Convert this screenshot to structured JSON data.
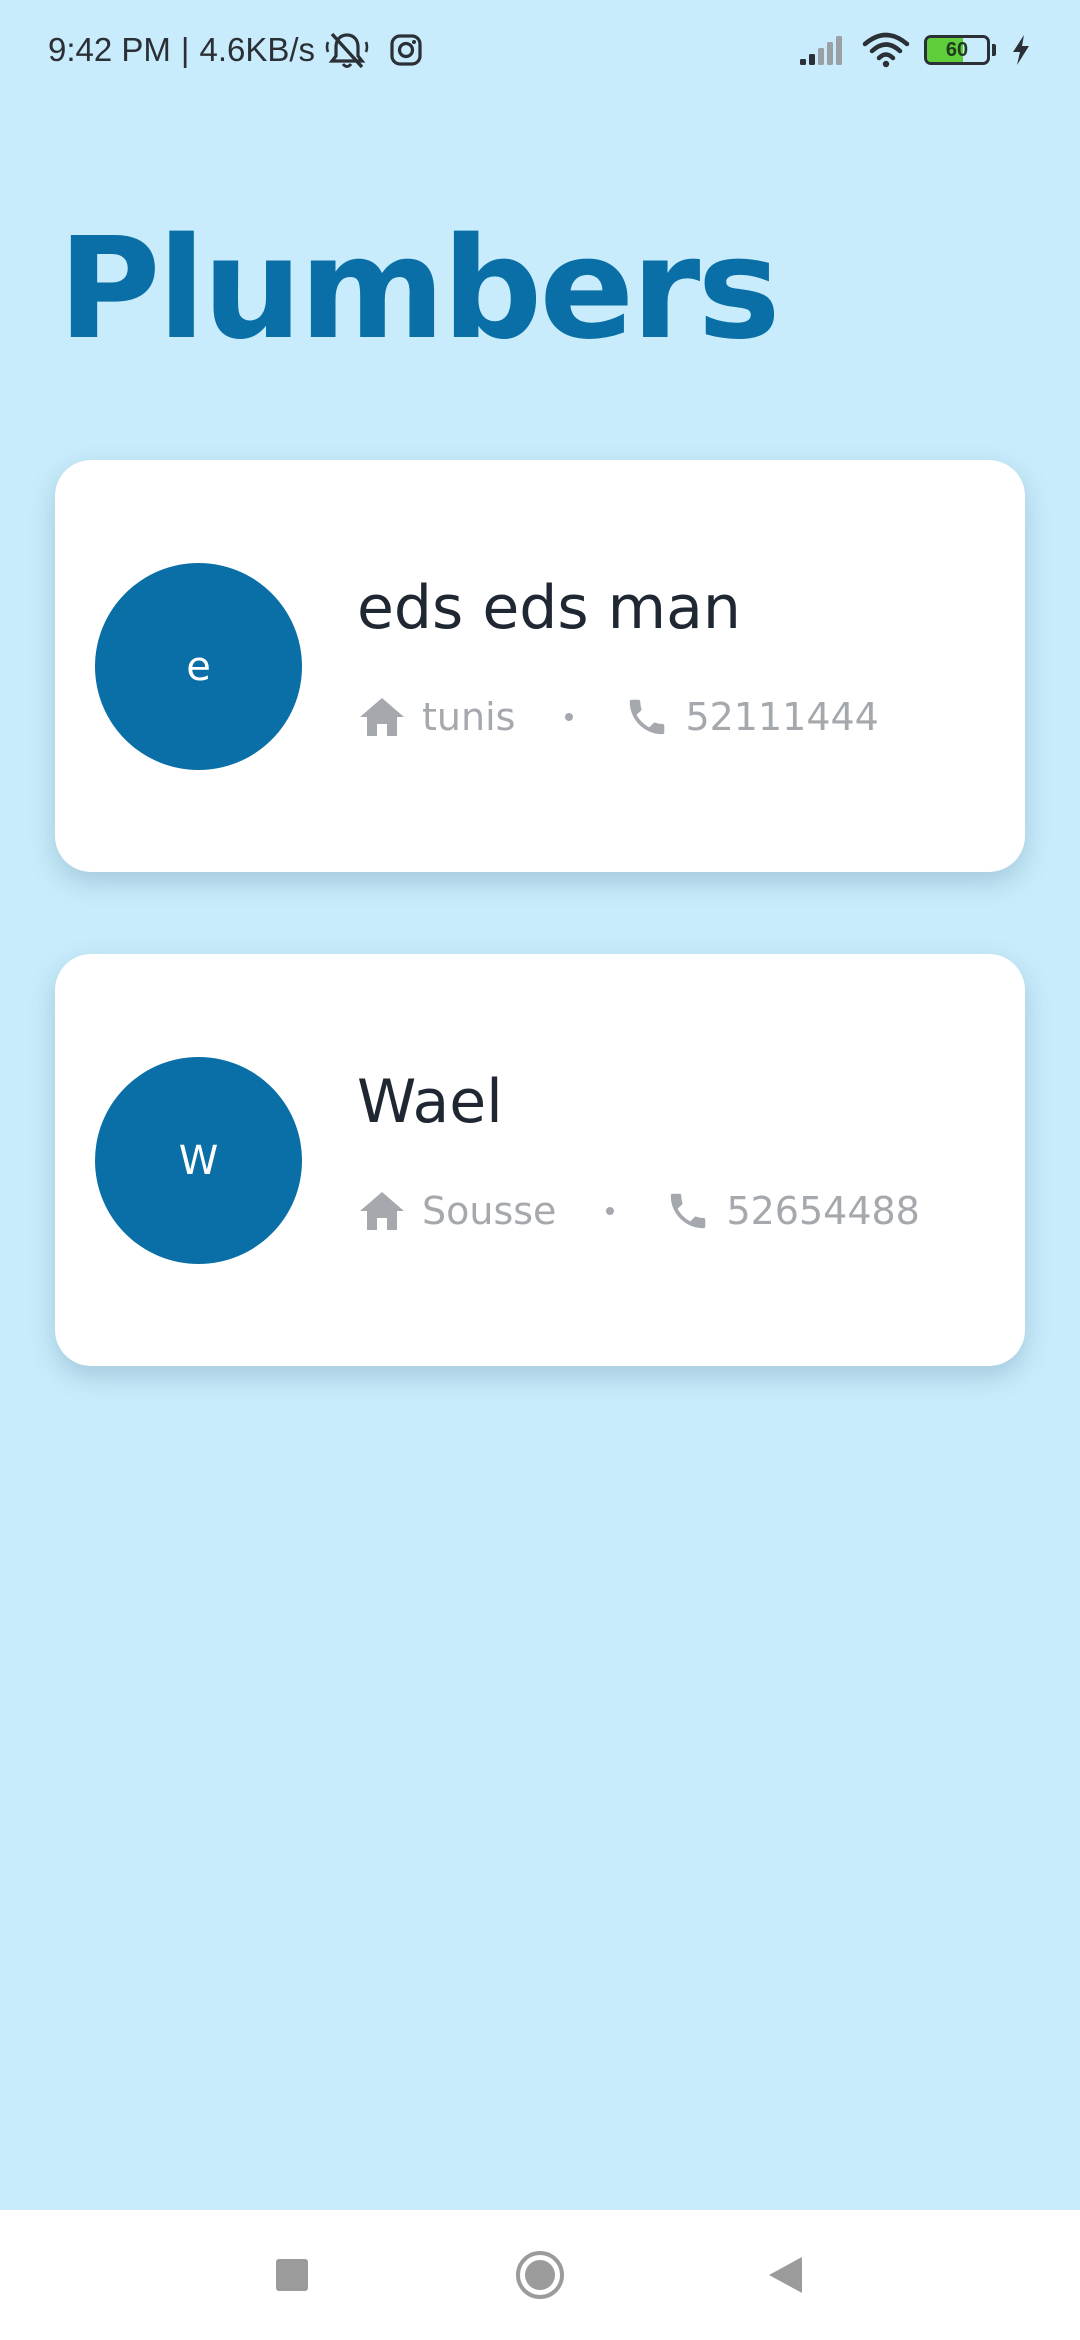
{
  "status_bar": {
    "time": "9:42 PM",
    "separator": "|",
    "network_speed": "4.6KB/s",
    "battery_level": "60",
    "battery_fraction": 0.6,
    "icons": [
      "mute-bell-icon",
      "instagram-icon",
      "signal-icon",
      "wifi-icon",
      "battery-icon",
      "charging-icon"
    ]
  },
  "page": {
    "title": "Plumbers"
  },
  "plumbers": [
    {
      "initial": "e",
      "name": "eds eds man",
      "city": "tunis",
      "phone": "52111444"
    },
    {
      "initial": "W",
      "name": "Wael",
      "city": "Sousse",
      "phone": "52654488"
    }
  ],
  "colors": {
    "background": "#c8ecfb",
    "accent": "#0a6fa6",
    "card": "#ffffff",
    "name_text": "#1f2733",
    "meta_text": "#a5a8ad"
  },
  "nav_bar": {
    "icons": [
      "recents-square-icon",
      "home-circle-icon",
      "back-triangle-icon"
    ]
  }
}
